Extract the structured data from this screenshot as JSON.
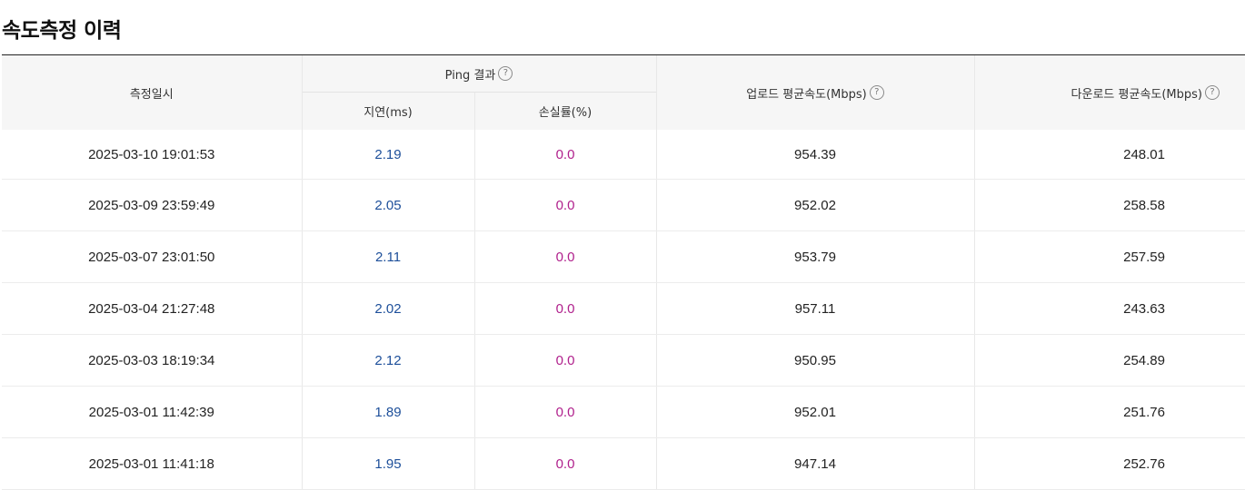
{
  "page": {
    "title": "속도측정 이력"
  },
  "table": {
    "headers": {
      "date": "측정일시",
      "ping_group": "Ping 결과",
      "latency": "지연(ms)",
      "loss": "손실률(%)",
      "upload": "업로드 평균속도(Mbps)",
      "download": "다운로드 평균속도(Mbps)"
    },
    "help_icon_glyph": "?",
    "rows": [
      {
        "date": "2025-03-10 19:01:53",
        "latency": "2.19",
        "loss": "0.0",
        "upload": "954.39",
        "download": "248.01"
      },
      {
        "date": "2025-03-09 23:59:49",
        "latency": "2.05",
        "loss": "0.0",
        "upload": "952.02",
        "download": "258.58"
      },
      {
        "date": "2025-03-07 23:01:50",
        "latency": "2.11",
        "loss": "0.0",
        "upload": "953.79",
        "download": "257.59"
      },
      {
        "date": "2025-03-04 21:27:48",
        "latency": "2.02",
        "loss": "0.0",
        "upload": "957.11",
        "download": "243.63"
      },
      {
        "date": "2025-03-03 18:19:34",
        "latency": "2.12",
        "loss": "0.0",
        "upload": "950.95",
        "download": "254.89"
      },
      {
        "date": "2025-03-01 11:42:39",
        "latency": "1.89",
        "loss": "0.0",
        "upload": "952.01",
        "download": "251.76"
      },
      {
        "date": "2025-03-01 11:41:18",
        "latency": "1.95",
        "loss": "0.0",
        "upload": "947.14",
        "download": "252.76"
      }
    ]
  },
  "colors": {
    "latency_text": "#1d4f9a",
    "loss_text": "#b0208c",
    "header_bg": "#f6f6f6",
    "top_border": "#222222"
  },
  "icons": {
    "help": "question-circle-icon"
  }
}
